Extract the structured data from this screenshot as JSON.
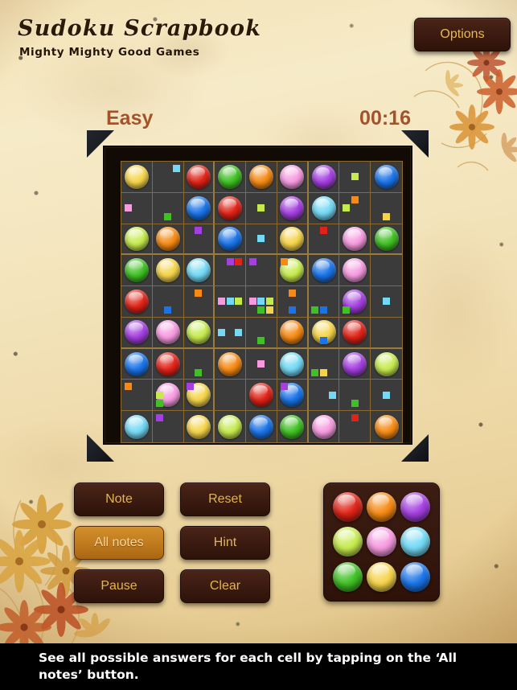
{
  "app": {
    "title": "Sudoku Scrapbook",
    "subtitle": "Mighty Mighty Good Games"
  },
  "header": {
    "options_label": "Options",
    "difficulty": "Easy",
    "timer": "00:16",
    "text_color": "#a3522a"
  },
  "controls": {
    "note": "Note",
    "all_notes": "All notes",
    "pause": "Pause",
    "reset": "Reset",
    "hint": "Hint",
    "clear": "Clear",
    "active_button": "All notes"
  },
  "caption": {
    "text": "See all possible answers for each cell by tapping on the ‘All notes’ button."
  },
  "palette": {
    "label": "Color picker",
    "colors": [
      {
        "name": "red",
        "hex": "#e02318"
      },
      {
        "name": "orange",
        "hex": "#f68a14"
      },
      {
        "name": "purple",
        "hex": "#a43fe0"
      },
      {
        "name": "lime",
        "hex": "#c6ea4e"
      },
      {
        "name": "pink",
        "hex": "#f79ae0"
      },
      {
        "name": "cyan",
        "hex": "#73d9f5"
      },
      {
        "name": "green",
        "hex": "#3fc023"
      },
      {
        "name": "yellow",
        "hex": "#f5d44a"
      },
      {
        "name": "blue",
        "hex": "#1a74e8"
      }
    ]
  },
  "board": {
    "size": 9,
    "cell_background": "#3b3b3b",
    "grid_line_color": "#8a6a2e",
    "color_map": {
      "1": "#e02318",
      "2": "#f68a14",
      "3": "#a43fe0",
      "4": "#c6ea4e",
      "5": "#f79ae0",
      "6": "#73d9f5",
      "7": "#3fc023",
      "8": "#f5d44a",
      "9": "#1a74e8"
    },
    "cells": [
      [
        {
          "v": 8
        },
        {
          "n": [
            6
          ]
        },
        {
          "v": 1
        },
        {
          "v": 7
        },
        {
          "v": 2
        },
        {
          "v": 5
        },
        {
          "v": 3
        },
        {
          "n": [
            4
          ]
        },
        {
          "v": 9
        }
      ],
      [
        {
          "n": [
            5
          ]
        },
        {
          "n": [
            7
          ]
        },
        {
          "v": 9
        },
        {
          "v": 1
        },
        {
          "n": [
            4
          ]
        },
        {
          "v": 3
        },
        {
          "v": 6
        },
        {
          "n": [
            4,
            2
          ]
        },
        {
          "n": [
            8
          ]
        }
      ],
      [
        {
          "v": 4
        },
        {
          "v": 2
        },
        {
          "n": [
            3
          ]
        },
        {
          "v": 9
        },
        {
          "n": [
            6
          ]
        },
        {
          "v": 8
        },
        {
          "n": [
            1
          ]
        },
        {
          "v": 5
        },
        {
          "v": 7
        }
      ],
      [
        {
          "v": 7
        },
        {
          "v": 8
        },
        {
          "v": 6
        },
        {
          "n": [
            3,
            1,
            3
          ]
        },
        {
          "n": [
            2
          ]
        },
        {
          "v": 4
        },
        {
          "v": 9
        },
        {
          "v": 5
        },
        {
          "v": 0
        }
      ],
      [
        {
          "v": 1
        },
        {
          "n": [
            9
          ]
        },
        {
          "n": [
            2
          ]
        },
        {
          "n": [
            5,
            6,
            4,
            5,
            6,
            4,
            7,
            8
          ]
        },
        {
          "n": [
            2,
            9,
            7
          ]
        },
        {
          "n": [
            7
          ]
        },
        {
          "n": [
            3
          ]
        },
        {
          "v": 3
        },
        {
          "v": 0
        }
      ],
      [
        {
          "v": 3
        },
        {
          "v": 5
        },
        {
          "v": 4
        },
        {
          "n": [
            6,
            7,
            6
          ]
        },
        {
          "n": [
            9
          ]
        },
        {
          "v": 2
        },
        {
          "v": 8
        },
        {
          "v": 1
        },
        {
          "v": 0
        }
      ],
      [
        {
          "v": 9
        },
        {
          "v": 1
        },
        {
          "n": [
            7
          ]
        },
        {
          "v": 2
        },
        {
          "n": [
            5
          ]
        },
        {
          "v": 6
        },
        {
          "n": [
            7,
            8
          ]
        },
        {
          "v": 3
        },
        {
          "v": 4
        }
      ],
      [
        {
          "n": [
            2,
            4,
            7
          ]
        },
        {
          "v": 5
        },
        {
          "v": 8
        },
        {
          "n": [
            3
          ]
        },
        {
          "v": 1
        },
        {
          "v": 9
        },
        {
          "n": [
            7,
            6
          ]
        },
        {
          "n": [
            6
          ]
        },
        {
          "v": 0
        }
      ],
      [
        {
          "v": 6
        },
        {
          "n": [
            3
          ]
        },
        {
          "v": 8
        },
        {
          "v": 4
        },
        {
          "v": 9
        },
        {
          "v": 7
        },
        {
          "v": 5
        },
        {
          "n": [
            1
          ]
        },
        {
          "v": 2
        }
      ]
    ]
  }
}
